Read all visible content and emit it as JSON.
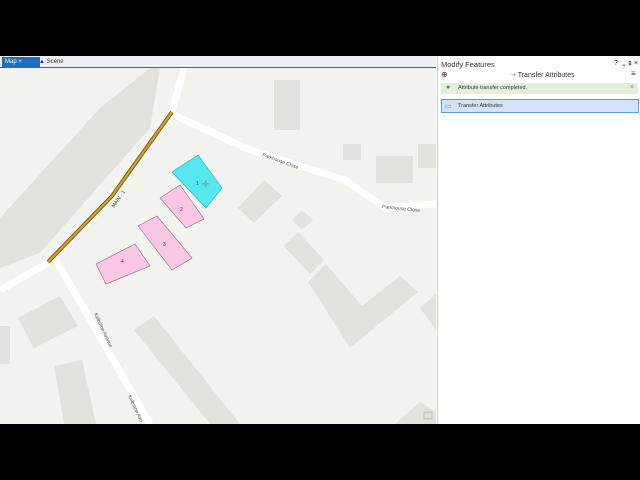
{
  "tabs": [
    {
      "label": "Map",
      "close": "×"
    },
    {
      "label": "Scene"
    }
  ],
  "map": {
    "roads": {
      "main": "MAIN - 1",
      "close1": "Parkhouse Close",
      "close2": "Parkhouse Close",
      "avenue1": "Kelbston Avenue",
      "avenue2": "Kelbston Ave"
    },
    "parcels": [
      "1",
      "2",
      "3",
      "4"
    ],
    "colors": {
      "selected": "#55e8f0",
      "parcel": "#f9c6e3",
      "line": "#c8901a"
    }
  },
  "pane": {
    "title": "Modify Features",
    "help": "?",
    "menu": "⌄",
    "pin": "⇞",
    "close": "×",
    "back": "⊕",
    "tool_title": "Transfer Attributes",
    "notice": "Attribute transfer completed.",
    "notice_close": "×",
    "tool_item": "Transfer Attributes"
  }
}
